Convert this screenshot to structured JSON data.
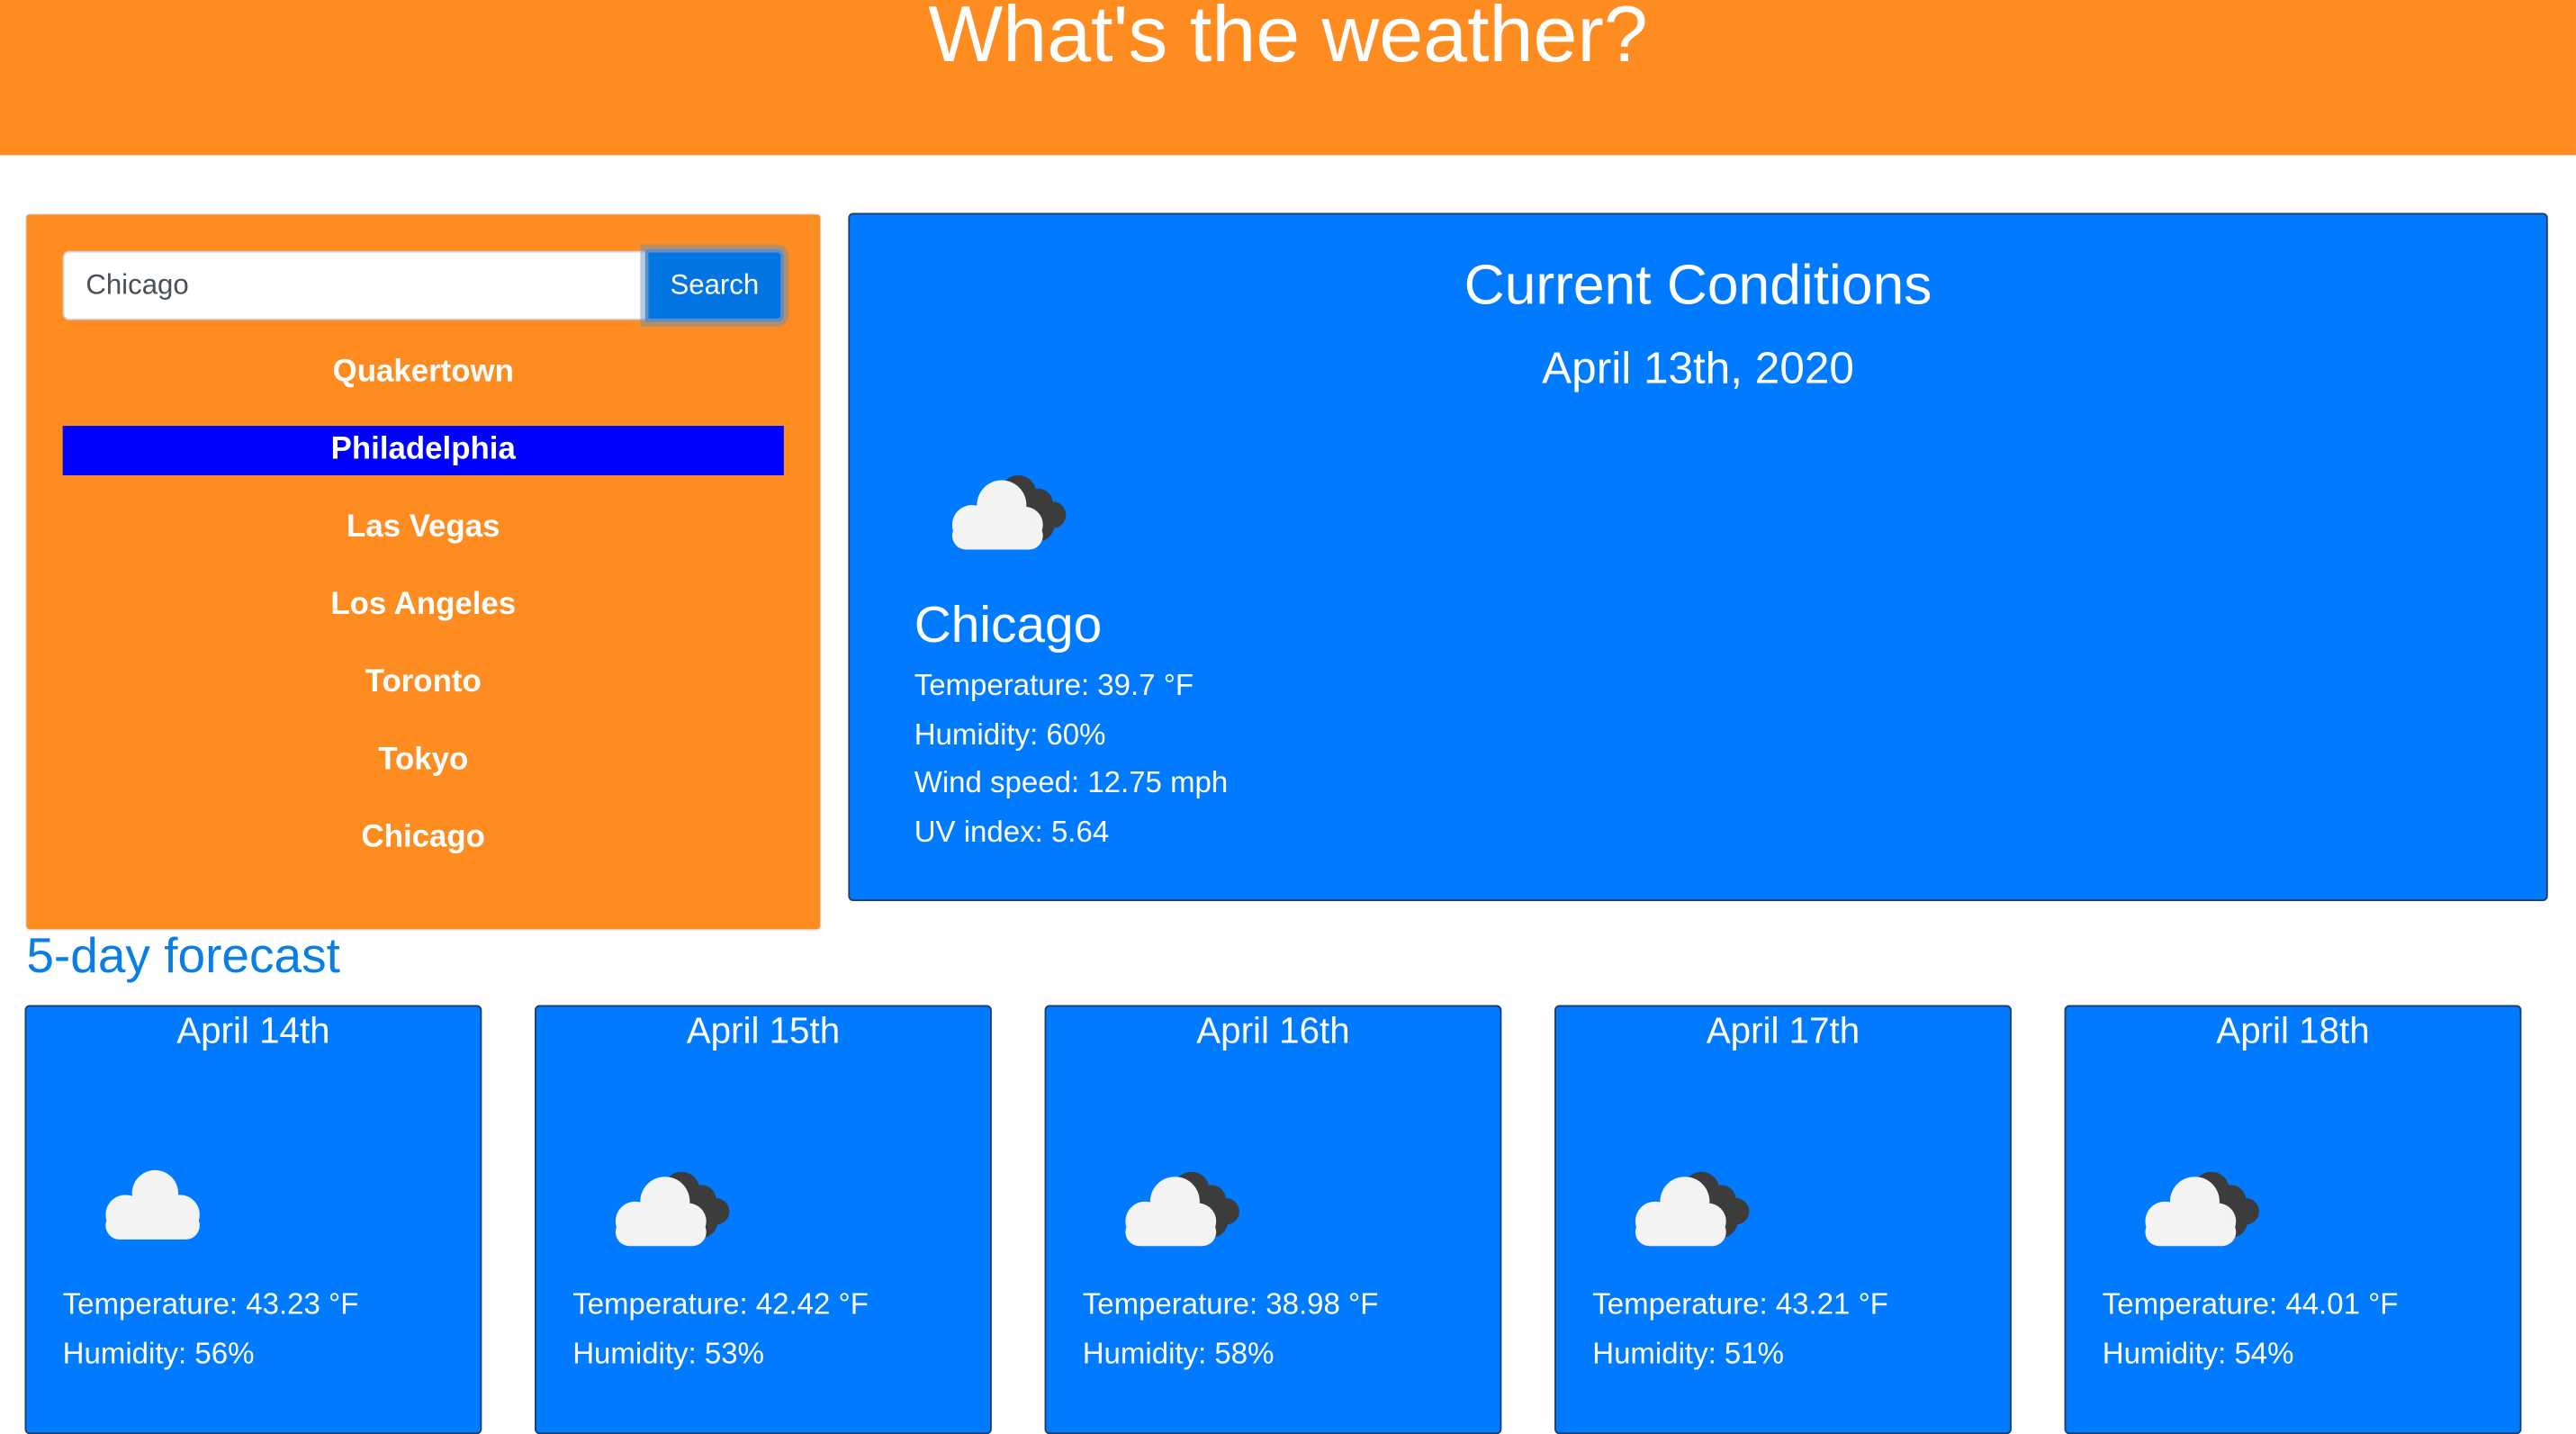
{
  "header": {
    "title": "What's the weather?"
  },
  "search": {
    "value": "Chicago",
    "button_label": "Search"
  },
  "cities": [
    "Quakertown",
    "Philadelphia",
    "Las Vegas",
    "Los Angeles",
    "Toronto",
    "Tokyo",
    "Chicago"
  ],
  "current": {
    "heading": "Current Conditions",
    "date": "April 13th, 2020",
    "icon": "cloudy-icon",
    "city": "Chicago",
    "temperature": "Temperature: 39.7 °F",
    "humidity": "Humidity: 60%",
    "wind": "Wind speed: 12.75 mph",
    "uv": "UV index: 5.64"
  },
  "forecast": {
    "heading": "5-day forecast",
    "days": [
      {
        "date": "April 14th",
        "icon": "cloud-icon",
        "temperature": "Temperature: 43.23 °F",
        "humidity": "Humidity: 56%"
      },
      {
        "date": "April 15th",
        "icon": "cloudy-icon",
        "temperature": "Temperature: 42.42 °F",
        "humidity": "Humidity: 53%"
      },
      {
        "date": "April 16th",
        "icon": "cloudy-icon",
        "temperature": "Temperature: 38.98 °F",
        "humidity": "Humidity: 58%"
      },
      {
        "date": "April 17th",
        "icon": "cloudy-icon",
        "temperature": "Temperature: 43.21 °F",
        "humidity": "Humidity: 51%"
      },
      {
        "date": "April 18th",
        "icon": "cloudy-icon",
        "temperature": "Temperature: 44.01 °F",
        "humidity": "Humidity: 54%"
      }
    ]
  },
  "colors": {
    "accent_orange": "#ff8c21",
    "panel_blue": "#007bff",
    "active_city": "#0000ff",
    "forecast_heading": "#0b7ee6"
  }
}
